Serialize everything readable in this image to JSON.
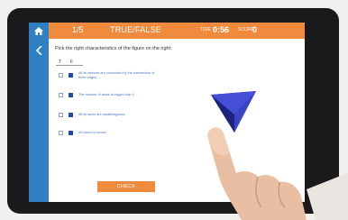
{
  "header": {
    "counter": "1/5",
    "title": "TRUE/FALSE",
    "timer_label": "TIME",
    "timer": "0:56",
    "score_label": "SCORE",
    "score": "0"
  },
  "question": "Pick the right characteristics of the figure on the right:",
  "columns": {
    "true": "T",
    "false": "F"
  },
  "statements": [
    "All its vertices are connected by the intersection of three edges",
    "The number of faces is bigger than 4",
    "All its faces are parallelograms",
    "All faces is convex"
  ],
  "check_label": "CHECK",
  "colors": {
    "accent": "#f08a3d",
    "nav": "#2f7fc4",
    "checkbox": "#1f4fa8"
  }
}
